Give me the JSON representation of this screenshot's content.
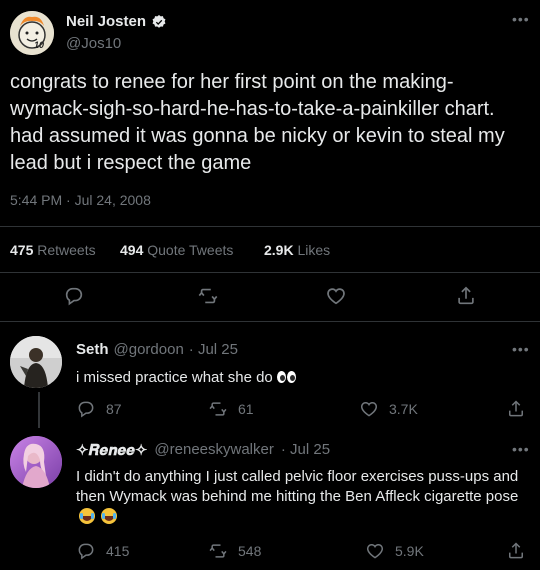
{
  "tweet": {
    "author_name": "Neil Josten",
    "author_handle": "@Jos10",
    "text": "congrats to renee for her first point on the making-wymack-sigh-so-hard-he-has-to-take-a-painkiller chart. had assumed it was gonna be nicky or kevin to steal my lead but i respect the game",
    "timestamp": "5:44 PM · Jul 24, 2008",
    "retweets_count": "475",
    "retweets_label": "Retweets",
    "quotes_count": "494",
    "quotes_label": "Quote Tweets",
    "likes_count": "2.9K",
    "likes_label": "Likes",
    "avatar_text": "10"
  },
  "replies": [
    {
      "name": "Seth",
      "handle": "@gordoon",
      "date": "· Jul 25",
      "text": "i missed practice what she do",
      "replies": "87",
      "retweets": "61",
      "likes": "3.7K"
    },
    {
      "name": "✧𝑹𝒆𝒏𝒆𝒆✧",
      "handle": "@reneeskywalker",
      "date": "· Jul 25",
      "text": "I didn't do anything I just called pelvic floor exercises puss-ups and then Wymack was behind me hitting the Ben Affleck cigarette pose",
      "replies": "415",
      "retweets": "548",
      "likes": "5.9K"
    }
  ],
  "icons": {
    "verified": "verified-badge-icon",
    "more": "more-icon",
    "reply": "reply-icon",
    "retweet": "retweet-icon",
    "like": "heart-icon",
    "share": "share-icon"
  },
  "colors": {
    "background": "#000000",
    "text": "#e7e9ea",
    "secondary": "#71767b",
    "divider": "#2f3336"
  }
}
